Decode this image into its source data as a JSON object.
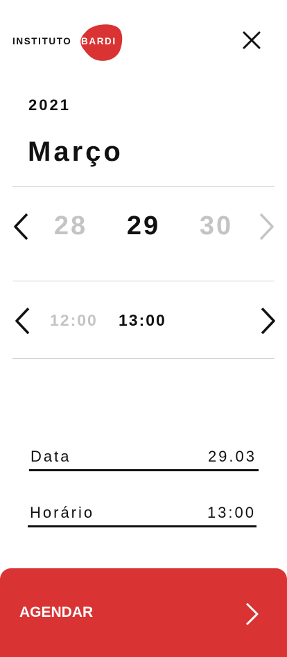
{
  "header": {
    "logo_text_dark": "INSTITUTO",
    "logo_text_light": "BARDI",
    "brand_color": "#d93333",
    "close_icon": "close-icon"
  },
  "calendar": {
    "year": "2021",
    "month": "Março",
    "days": {
      "previous": "28",
      "selected": "29",
      "next": "30"
    },
    "times": {
      "previous": "12:00",
      "selected": "13:00"
    }
  },
  "summary": {
    "date_label": "Data",
    "date_value": "29.03",
    "time_label": "Horário",
    "time_value": "13:00"
  },
  "cta": {
    "label": "AGENDAR",
    "icon": "chevron-right-icon"
  }
}
